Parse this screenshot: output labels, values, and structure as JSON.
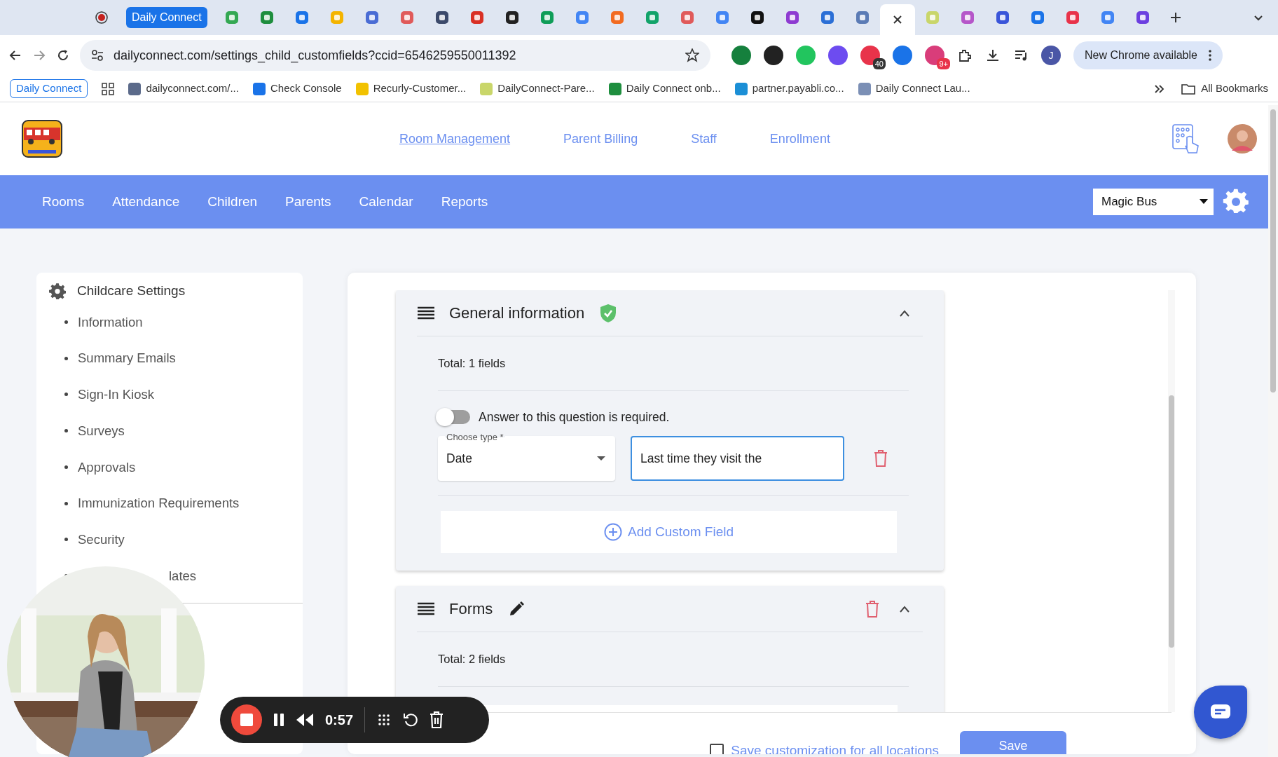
{
  "browser": {
    "record_tab": {
      "color": "#c5221f"
    },
    "tab_group": "Daily Connect",
    "tabs": [
      {
        "color": "#34a853",
        "selected": false
      },
      {
        "color": "#1e8e3e",
        "selected": false
      },
      {
        "color": "#1a73e8",
        "selected": false
      },
      {
        "color": "#f4b400",
        "selected": false
      },
      {
        "color": "#4a6cd4",
        "selected": false
      },
      {
        "color": "#e05a5a",
        "selected": false
      },
      {
        "color": "#3c4a6b",
        "selected": false
      },
      {
        "color": "#d93025",
        "selected": false
      },
      {
        "color": "#222222",
        "selected": false
      },
      {
        "color": "#0f9d58",
        "selected": false
      },
      {
        "color": "#4285f4",
        "selected": false
      },
      {
        "color": "#f26b21",
        "selected": false
      },
      {
        "color": "#12a36a",
        "selected": false
      },
      {
        "color": "#e05a5a",
        "selected": false
      },
      {
        "color": "#4285f4",
        "selected": false
      },
      {
        "color": "#111111",
        "selected": false
      },
      {
        "color": "#8e3bd1",
        "selected": false
      },
      {
        "color": "#2b6fd6",
        "selected": false
      },
      {
        "color": "#5b7bb5",
        "selected": false
      },
      {
        "selected": true
      },
      {
        "color": "#c9d66a",
        "selected": false
      },
      {
        "color": "#b556c9",
        "selected": false
      },
      {
        "color": "#3a55d9",
        "selected": false
      },
      {
        "color": "#1a73e8",
        "selected": false
      },
      {
        "color": "#e8334a",
        "selected": false
      },
      {
        "color": "#4285f4",
        "selected": false
      },
      {
        "color": "#6c3fe0",
        "selected": false
      }
    ],
    "address": "dailyconnect.com/settings_child_customfields?ccid=6546259550011392",
    "extensions": [
      {
        "color": "#15803d"
      },
      {
        "color": "#222222"
      },
      {
        "color": "#22c55e"
      },
      {
        "color": "#6d4cf0"
      },
      {
        "color": "#e8334a",
        "badge": "40"
      },
      {
        "color": "#1a73e8"
      },
      {
        "color": "#d93d7a",
        "badge": "9+"
      }
    ],
    "profile": "J",
    "update_button": "New Chrome available",
    "bookmark_group": "Daily Connect",
    "bookmarks": [
      {
        "label": "dailyconnect.com/...",
        "color": "#5b6a8a"
      },
      {
        "label": "Check Console",
        "color": "#1a73e8"
      },
      {
        "label": "Recurly-Customer...",
        "color": "#f2c200"
      },
      {
        "label": "DailyConnect-Pare...",
        "color": "#c9d66a"
      },
      {
        "label": "Daily Connect onb...",
        "color": "#1e8e3e"
      },
      {
        "label": "partner.payabli.co...",
        "color": "#1b8fd6"
      },
      {
        "label": "Daily Connect Lau...",
        "color": "#7b8fb5"
      }
    ],
    "all_bookmarks": "All Bookmarks"
  },
  "app": {
    "top_links": [
      {
        "label": "Room Management",
        "selected": true
      },
      {
        "label": "Parent Billing",
        "selected": false
      },
      {
        "label": "Staff",
        "selected": false
      },
      {
        "label": "Enrollment",
        "selected": false
      }
    ],
    "nav": [
      "Rooms",
      "Attendance",
      "Children",
      "Parents",
      "Calendar",
      "Reports"
    ],
    "location_select": "Magic Bus",
    "sidebar": {
      "title": "Childcare Settings",
      "items": [
        "Information",
        "Summary Emails",
        "Sign-In Kiosk",
        "Surveys",
        "Approvals",
        "Immunization Requirements",
        "Security",
        "lates"
      ]
    },
    "sections": [
      {
        "title": "General information",
        "verified": true,
        "editable": false,
        "deletable": false,
        "total": "Total: 1 fields",
        "fields": [
          {
            "required": false,
            "required_label": "Answer to this question is required.",
            "type_label": "Choose type *",
            "type": "Date",
            "name": "Last time they visit the",
            "focused": true
          }
        ],
        "add_button": "Add Custom Field"
      },
      {
        "title": "Forms",
        "verified": false,
        "editable": true,
        "deletable": true,
        "total": "Total: 2 fields"
      }
    ],
    "footer": {
      "save_all": {
        "label": "Save customization for all locations",
        "checked": false
      },
      "save_button": "Save"
    }
  },
  "recorder": {
    "time": "0:57"
  }
}
